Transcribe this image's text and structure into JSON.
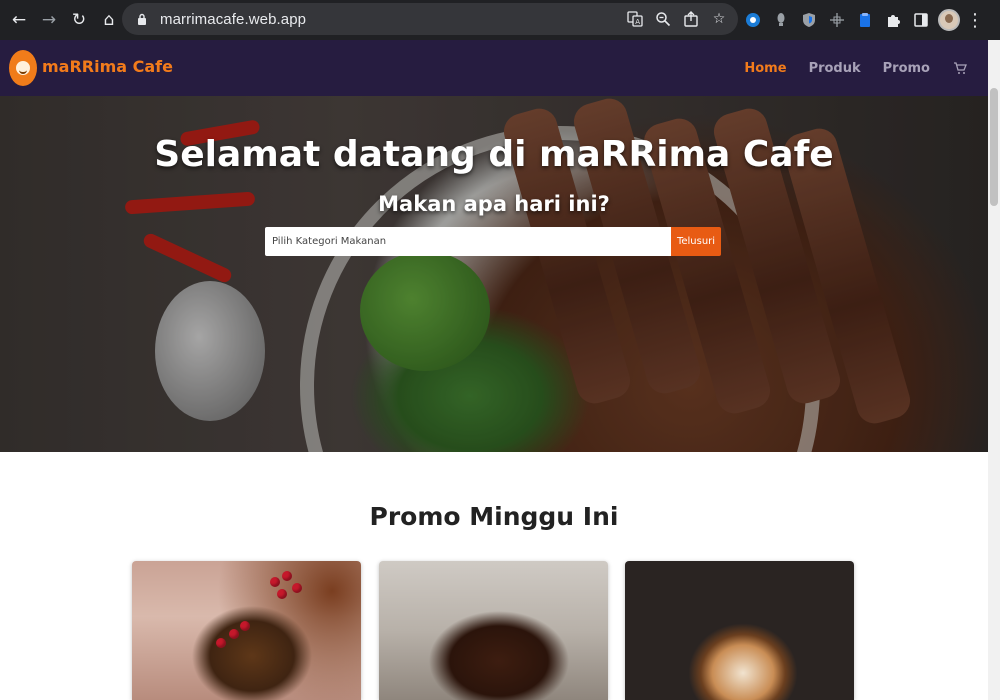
{
  "browser": {
    "url": "marrimacafe.web.app",
    "nav_icons": [
      "back-arrow-icon",
      "forward-arrow-icon",
      "reload-icon",
      "home-icon"
    ],
    "omnibox_icons": [
      "translate-icon",
      "zoom-icon",
      "share-icon",
      "bookmark-star-icon"
    ],
    "extension_icons": [
      "extension-edge-icon",
      "extension-bulb-icon",
      "extension-shield-icon",
      "extension-crosshair-icon",
      "extension-clipboard-icon",
      "puzzle-icon",
      "sidebar-icon",
      "profile-avatar-icon",
      "kebab-menu-icon"
    ]
  },
  "navbar": {
    "brand": "maRRima Cafe",
    "menu": [
      {
        "label": "Home",
        "active": true
      },
      {
        "label": "Produk",
        "active": false
      },
      {
        "label": "Promo",
        "active": false
      }
    ],
    "cart_icon": "cart-icon",
    "colors": {
      "background": "#261c40",
      "accent": "#f27b1b",
      "muted": "#a8a2b8"
    }
  },
  "hero": {
    "title": "Selamat datang di maRRima Cafe",
    "subtitle": "Makan apa hari ini?",
    "search": {
      "placeholder": "Pilih Kategori Makanan",
      "value": "",
      "button_label": "Telusuri",
      "button_color": "#e85b13"
    }
  },
  "promo": {
    "title": "Promo Minggu Ini",
    "cards": [
      {
        "image": "chocolate-mousse-with-raspberries"
      },
      {
        "image": "chocolate-lava-cake"
      },
      {
        "image": "latte-art-coffee"
      }
    ]
  }
}
